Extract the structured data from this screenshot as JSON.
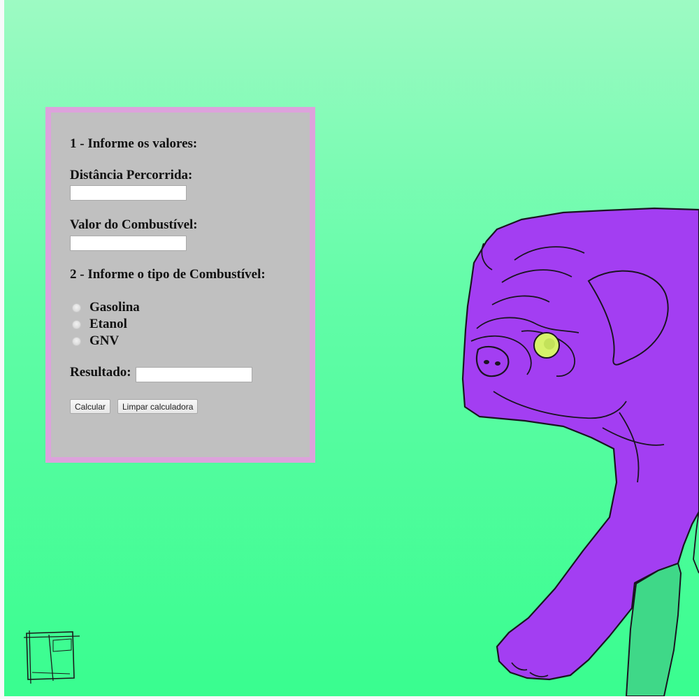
{
  "form": {
    "step1_title": "1 - Informe os valores:",
    "distance_label": "Distância Percorrida:",
    "distance_value": "",
    "fuel_price_label": "Valor do Combustível:",
    "fuel_price_value": "",
    "step2_title": "2 - Informe o tipo de Combustível:",
    "fuel_options": [
      {
        "label": "Gasolina",
        "checked": false
      },
      {
        "label": "Etanol",
        "checked": false
      },
      {
        "label": "GNV",
        "checked": false
      }
    ],
    "result_label": "Resultado:",
    "result_value": "",
    "calculate_label": "Calcular",
    "clear_label": "Limpar calculadora"
  },
  "colors": {
    "background_top": "#9dfac3",
    "background_bottom": "#39fd8f",
    "panel_fill": "#c0c0c0",
    "panel_border": "#dda2dc",
    "pug_fill": "#a33ef2",
    "pug_eye": "#d6f26a"
  },
  "icons": {
    "signature_mark": "sketch-square-icon",
    "illustration": "pug-illustration"
  }
}
